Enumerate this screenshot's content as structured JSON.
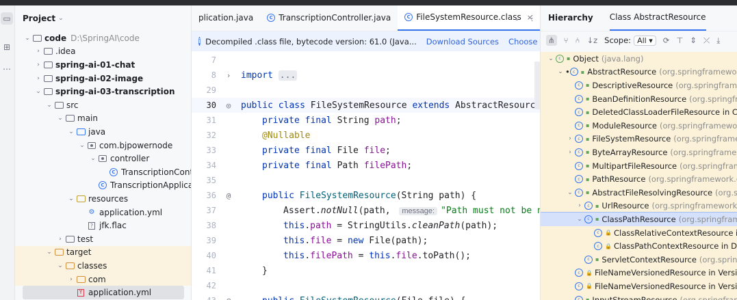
{
  "project_panel": {
    "title": "Project",
    "tree": [
      {
        "label": "code",
        "path": "D:\\SpringAI\\code",
        "depth": 0,
        "expanded": true,
        "icon": "folder-icon",
        "bold": true
      },
      {
        "label": ".idea",
        "depth": 1,
        "expanded": false,
        "icon": "folder-icon"
      },
      {
        "label": "spring-ai-01-chat",
        "depth": 1,
        "expanded": false,
        "icon": "module-icon",
        "bold": true
      },
      {
        "label": "spring-ai-02-image",
        "depth": 1,
        "expanded": false,
        "icon": "module-icon",
        "bold": true
      },
      {
        "label": "spring-ai-03-transcription",
        "depth": 1,
        "expanded": true,
        "icon": "module-icon",
        "bold": true
      },
      {
        "label": "src",
        "depth": 2,
        "expanded": true,
        "icon": "folder-icon"
      },
      {
        "label": "main",
        "depth": 3,
        "expanded": true,
        "icon": "folder-icon"
      },
      {
        "label": "java",
        "depth": 4,
        "expanded": true,
        "icon": "source-folder-icon"
      },
      {
        "label": "com.bjpowernode",
        "depth": 5,
        "expanded": true,
        "icon": "package-icon"
      },
      {
        "label": "controller",
        "depth": 6,
        "expanded": true,
        "icon": "package-icon"
      },
      {
        "label": "TranscriptionControll",
        "depth": 7,
        "icon": "class-icon"
      },
      {
        "label": "TranscriptionApplication",
        "depth": 6,
        "icon": "spring-class-icon"
      },
      {
        "label": "resources",
        "depth": 4,
        "expanded": true,
        "icon": "resources-folder-icon"
      },
      {
        "label": "application.yml",
        "depth": 5,
        "icon": "yaml-icon"
      },
      {
        "label": "jfk.flac",
        "depth": 5,
        "icon": "unknown-file-icon"
      },
      {
        "label": "test",
        "depth": 3,
        "expanded": false,
        "icon": "folder-icon"
      },
      {
        "label": "target",
        "depth": 2,
        "expanded": true,
        "icon": "excluded-folder-icon",
        "target": true
      },
      {
        "label": "classes",
        "depth": 3,
        "expanded": true,
        "icon": "excluded-folder-icon",
        "target": true
      },
      {
        "label": "com",
        "depth": 4,
        "expanded": false,
        "icon": "excluded-folder-icon",
        "target": true
      },
      {
        "label": "application.yml",
        "depth": 4,
        "icon": "yaml-red-icon",
        "target": true,
        "selected": true
      }
    ]
  },
  "editor": {
    "tabs": [
      {
        "label": "plication.java",
        "icon": "java-icon",
        "active": false
      },
      {
        "label": "TranscriptionController.java",
        "icon": "class-icon",
        "active": false
      },
      {
        "label": "FileSystemResource.class",
        "icon": "class-icon",
        "active": true,
        "close": "×"
      }
    ],
    "tab_tools": {
      "more_tabs": "⌄",
      "menu": "⋮"
    },
    "banner": {
      "text": "Decompiled .class file, bytecode version: 61.0 (Java...",
      "download": "Download Sources",
      "choose": "Choose Sources..."
    },
    "lines": [
      {
        "n": "7",
        "gutter": ""
      },
      {
        "n": "8",
        "gutter": "›",
        "tokens": [
          [
            "kw",
            "import "
          ],
          [
            "fold",
            "..."
          ]
        ]
      },
      {
        "n": "29",
        "gutter": ""
      },
      {
        "n": "30",
        "gutter": "hierarchy",
        "current": true,
        "tokens": [
          [
            "kw",
            "public class "
          ],
          [
            "plain",
            "FileSystemResource "
          ],
          [
            "kw",
            "extends "
          ],
          [
            "plain",
            "AbstractResource"
          ]
        ]
      },
      {
        "n": "31",
        "indent": 1,
        "tokens": [
          [
            "kw",
            "private final "
          ],
          [
            "plain",
            "String "
          ],
          [
            "fld",
            "path"
          ],
          [
            "plain",
            ";"
          ]
        ]
      },
      {
        "n": "32",
        "indent": 1,
        "tokens": [
          [
            "an",
            "@Nullable"
          ]
        ]
      },
      {
        "n": "33",
        "indent": 1,
        "tokens": [
          [
            "kw",
            "private final "
          ],
          [
            "plain",
            "File "
          ],
          [
            "fld",
            "file"
          ],
          [
            "plain",
            ";"
          ]
        ]
      },
      {
        "n": "34",
        "indent": 1,
        "tokens": [
          [
            "kw",
            "private final "
          ],
          [
            "plain",
            "Path "
          ],
          [
            "fld",
            "filePath"
          ],
          [
            "plain",
            ";"
          ]
        ]
      },
      {
        "n": "35"
      },
      {
        "n": "36",
        "gutter": "@",
        "indent": 1,
        "tokens": [
          [
            "kw",
            "public "
          ],
          [
            "mth",
            "FileSystemResource"
          ],
          [
            "plain",
            "(String path) {"
          ]
        ]
      },
      {
        "n": "37",
        "indent": 2,
        "tokens": [
          [
            "plain",
            "Assert."
          ],
          [
            "it",
            "notNull"
          ],
          [
            "plain",
            "(path, "
          ],
          [
            "hint",
            "message:"
          ],
          [
            "str",
            "\"Path must not be n"
          ]
        ]
      },
      {
        "n": "38",
        "indent": 2,
        "tokens": [
          [
            "kw",
            "this"
          ],
          [
            "plain",
            "."
          ],
          [
            "fld",
            "path"
          ],
          [
            "plain",
            " = StringUtils."
          ],
          [
            "it",
            "cleanPath"
          ],
          [
            "plain",
            "(path);"
          ]
        ]
      },
      {
        "n": "39",
        "indent": 2,
        "tokens": [
          [
            "kw",
            "this"
          ],
          [
            "plain",
            "."
          ],
          [
            "fld",
            "file"
          ],
          [
            "plain",
            " = "
          ],
          [
            "kw",
            "new "
          ],
          [
            "plain",
            "File(path);"
          ]
        ]
      },
      {
        "n": "40",
        "indent": 2,
        "tokens": [
          [
            "kw",
            "this"
          ],
          [
            "plain",
            "."
          ],
          [
            "fld",
            "filePath"
          ],
          [
            "plain",
            " = "
          ],
          [
            "kw",
            "this"
          ],
          [
            "plain",
            "."
          ],
          [
            "fld",
            "file"
          ],
          [
            "plain",
            ".toPath();"
          ]
        ]
      },
      {
        "n": "41",
        "indent": 1,
        "tokens": [
          [
            "plain",
            "}"
          ]
        ]
      },
      {
        "n": "42"
      },
      {
        "n": "43",
        "gutter": "@",
        "indent": 1,
        "tokens": [
          [
            "kw",
            "public "
          ],
          [
            "mth",
            "FileSystemResource"
          ],
          [
            "plain",
            "(File file) {"
          ]
        ]
      }
    ]
  },
  "hierarchy_panel": {
    "tab_hierarchy": "Hierarchy",
    "tab_class": "Class AbstractResource",
    "toolbar": {
      "scope_label": "Scope:",
      "scope_value": "All"
    },
    "rows": [
      {
        "depth": 0,
        "arrow": "⌄",
        "name": "Object",
        "pkg": "(java.lang)"
      },
      {
        "depth": 1,
        "arrow": "⌄",
        "name": "AbstractResource",
        "pkg": "(org.springframework.c",
        "marker": true
      },
      {
        "depth": 2,
        "name": "DescriptiveResource",
        "pkg": "(org.springframewo"
      },
      {
        "depth": 2,
        "name": "BeanDefinitionResource",
        "pkg": "(org.springframe"
      },
      {
        "depth": 2,
        "name": "DeletedClassLoaderFileResource in Class",
        "pkg": ""
      },
      {
        "depth": 2,
        "name": "ModuleResource",
        "pkg": "(org.springframework.c"
      },
      {
        "depth": 2,
        "arrow": "›",
        "name": "FileSystemResource",
        "pkg": "(org.springframewo"
      },
      {
        "depth": 2,
        "arrow": "›",
        "name": "ByteArrayResource",
        "pkg": "(org.springframewor"
      },
      {
        "depth": 2,
        "name": "MultipartFileResource",
        "pkg": "(org.springframe"
      },
      {
        "depth": 2,
        "name": "PathResource",
        "pkg": "(org.springframework.core"
      },
      {
        "depth": 2,
        "arrow": "⌄",
        "name": "AbstractFileResolvingResource",
        "pkg": "(org.sprin"
      },
      {
        "depth": 3,
        "arrow": "›",
        "name": "UrlResource",
        "pkg": "(org.springframework.co"
      },
      {
        "depth": 3,
        "arrow": "⌄",
        "name": "ClassPathResource",
        "pkg": "(org.springframew",
        "selected": true
      },
      {
        "depth": 4,
        "name": "ClassRelativeContextResource in C",
        "pkg": "",
        "lock": true
      },
      {
        "depth": 4,
        "name": "ClassPathContextResource in Defa",
        "pkg": "",
        "lock": true
      },
      {
        "depth": 3,
        "name": "ServletContextResource",
        "pkg": "(org.springfra"
      },
      {
        "depth": 2,
        "name": "FileNameVersionedResource in VersionR",
        "pkg": "",
        "lock": true
      },
      {
        "depth": 2,
        "name": "FileNameVersionedResource in VersionR",
        "pkg": "",
        "lock": true
      },
      {
        "depth": 2,
        "name": "InputStreamResource",
        "pkg": "(org.springframe"
      }
    ]
  },
  "colors": {
    "accent": "#3574f0",
    "keyword": "#0033b3",
    "annotation": "#9e880d",
    "field": "#871094",
    "string": "#067d17"
  }
}
